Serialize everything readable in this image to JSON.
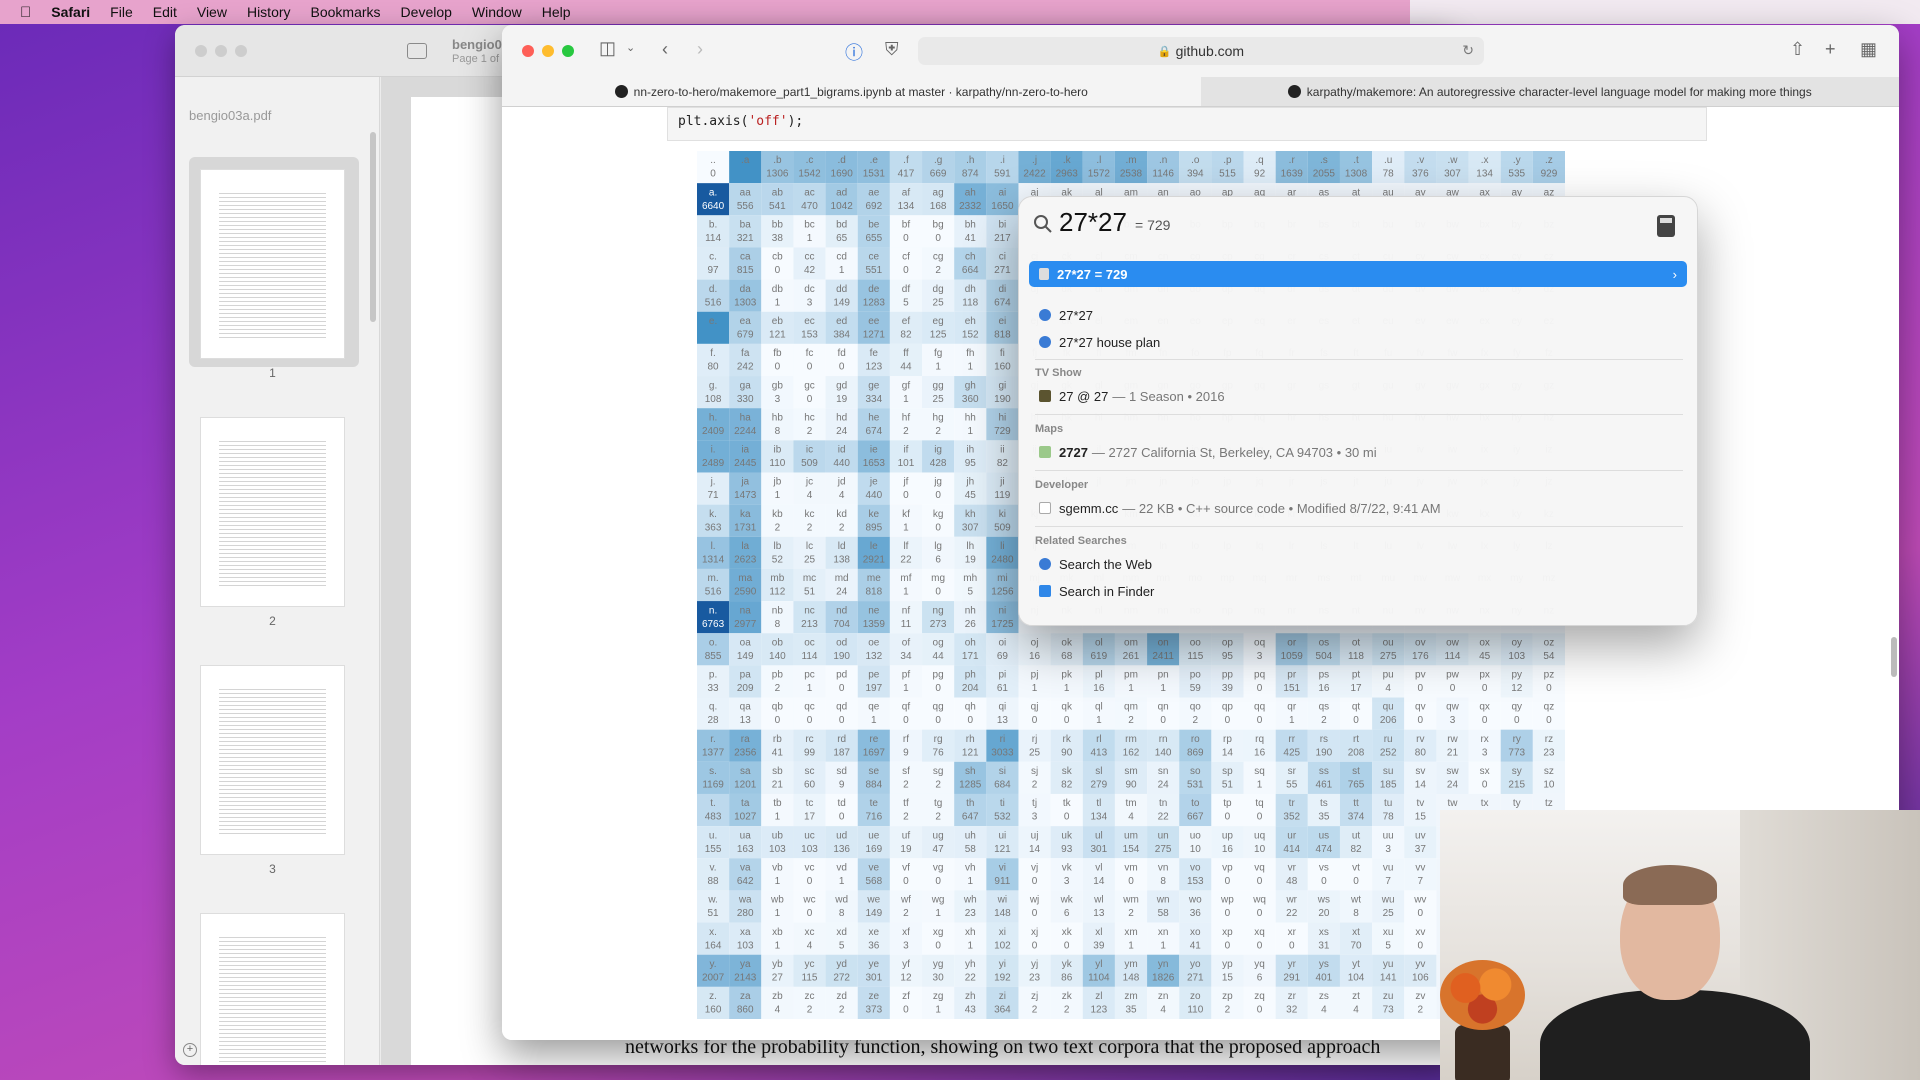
{
  "menubar": {
    "app": "Safari",
    "items": [
      "File",
      "Edit",
      "View",
      "History",
      "Bookmarks",
      "Develop",
      "Window",
      "Help"
    ]
  },
  "preview": {
    "doc_title": "bengio0",
    "page_info": "Page 1 of",
    "sidebar_label": "bengio03a.pdf",
    "thumb_numbers": [
      "1",
      "2",
      "3"
    ],
    "body_text": "networks for the probability function, showing on two text corpora that the proposed approach"
  },
  "safari": {
    "url": "github.com",
    "tabs": [
      {
        "label": "nn-zero-to-hero/makemore_part1_bigrams.ipynb at master · karpathy/nn-zero-to-hero",
        "active": true
      },
      {
        "label": "karpathy/makemore: An autoregressive character-level language model for making more things",
        "active": false
      }
    ],
    "code": {
      "prefix": "plt.axis(",
      "string": "'off'",
      "suffix": ");"
    }
  },
  "spotlight": {
    "query": "27*27",
    "inline_result": "= 729",
    "selected": "27*27 = 729",
    "suggestions": [
      {
        "label": "27*27",
        "icon": "safari-icon"
      },
      {
        "label": "27*27 house plan",
        "icon": "safari-icon"
      }
    ],
    "sections": [
      {
        "header": "TV Show",
        "items": [
          {
            "label": "27 @ 27",
            "meta": "— 1 Season • 2016",
            "icon": "tv-icon"
          }
        ]
      },
      {
        "header": "Maps",
        "items": [
          {
            "label": "2727",
            "meta": "— 2727 California St, Berkeley, CA 94703 • 30 mi",
            "icon": "maps-icon"
          }
        ]
      },
      {
        "header": "Developer",
        "items": [
          {
            "label": "sgemm.cc",
            "meta": "— 22 KB • C++ source code • Modified 8/7/22, 9:41 AM",
            "icon": "file-icon"
          }
        ]
      },
      {
        "header": "Related Searches",
        "items": [
          {
            "label": "Search the Web",
            "meta": "",
            "icon": "safari-icon"
          },
          {
            "label": "Search in Finder",
            "meta": "",
            "icon": "finder-icon"
          }
        ]
      }
    ]
  },
  "chart_data": {
    "type": "heatmap",
    "title": "",
    "columns": [
      ".",
      "a",
      "b",
      "c",
      "d",
      "e",
      "f",
      "g",
      "h",
      "i",
      "j",
      "k",
      "l",
      "m",
      "n",
      "o",
      "p",
      "q",
      "r",
      "s",
      "t",
      "u",
      "v",
      "w",
      "x",
      "y",
      "z"
    ],
    "rows": [
      {
        "label": ".",
        "values": [
          0,
          null,
          1306,
          1542,
          1690,
          1531,
          417,
          669,
          874,
          591,
          2422,
          2963,
          1572,
          2538,
          1146,
          394,
          515,
          92,
          1639,
          2055,
          1308,
          78,
          376,
          307,
          134,
          535,
          929
        ]
      },
      {
        "label": "a",
        "values": [
          6640,
          556,
          541,
          470,
          1042,
          692,
          134,
          168,
          2332,
          1650
        ]
      },
      {
        "label": "b",
        "values": [
          114,
          321,
          38,
          1,
          65,
          655,
          0,
          0,
          41,
          217
        ]
      },
      {
        "label": "c",
        "values": [
          97,
          815,
          0,
          42,
          1,
          551,
          0,
          2,
          664,
          271
        ]
      },
      {
        "label": "d",
        "values": [
          516,
          1303,
          1,
          3,
          149,
          1283,
          5,
          25,
          118,
          674
        ]
      },
      {
        "label": "e",
        "values": [
          null,
          679,
          121,
          153,
          384,
          1271,
          82,
          125,
          152,
          818
        ]
      },
      {
        "label": "f",
        "values": [
          80,
          242,
          0,
          0,
          0,
          123,
          44,
          1,
          1,
          160
        ]
      },
      {
        "label": "g",
        "values": [
          108,
          330,
          3,
          0,
          19,
          334,
          1,
          25,
          360,
          190
        ]
      },
      {
        "label": "h",
        "values": [
          2409,
          2244,
          8,
          2,
          24,
          674,
          2,
          2,
          1,
          729
        ]
      },
      {
        "label": "i",
        "values": [
          2489,
          2445,
          110,
          509,
          440,
          1653,
          101,
          428,
          95,
          82
        ]
      },
      {
        "label": "j",
        "values": [
          71,
          1473,
          1,
          4,
          4,
          440,
          0,
          0,
          45,
          119
        ]
      },
      {
        "label": "k",
        "values": [
          363,
          1731,
          2,
          2,
          2,
          895,
          1,
          0,
          307,
          509
        ]
      },
      {
        "label": "l",
        "values": [
          1314,
          2623,
          52,
          25,
          138,
          2921,
          22,
          6,
          19,
          2480
        ]
      },
      {
        "label": "m",
        "values": [
          516,
          2590,
          112,
          51,
          24,
          818,
          1,
          0,
          5,
          1256
        ]
      },
      {
        "label": "n",
        "values": [
          6763,
          2977,
          8,
          213,
          704,
          1359,
          11,
          273,
          26,
          1725
        ]
      },
      {
        "label": "o",
        "values": [
          855,
          149,
          140,
          114,
          190,
          132,
          34,
          44,
          171,
          69,
          16,
          68,
          619,
          261,
          2411,
          115,
          95,
          3,
          1059,
          504,
          118,
          275,
          176,
          114,
          45,
          103,
          54
        ]
      },
      {
        "label": "p",
        "values": [
          33,
          209,
          2,
          1,
          0,
          197,
          1,
          0,
          204,
          61,
          1,
          1,
          16,
          1,
          1,
          59,
          39,
          0,
          151,
          16,
          17,
          4,
          0,
          0,
          0,
          12,
          0
        ]
      },
      {
        "label": "q",
        "values": [
          28,
          13,
          0,
          0,
          0,
          1,
          0,
          0,
          0,
          13,
          0,
          0,
          1,
          2,
          0,
          2,
          0,
          0,
          1,
          2,
          0,
          206,
          0,
          3,
          0,
          0,
          0
        ]
      },
      {
        "label": "r",
        "values": [
          1377,
          2356,
          41,
          99,
          187,
          1697,
          9,
          76,
          121,
          3033,
          25,
          90,
          413,
          162,
          140,
          869,
          14,
          16,
          425,
          190,
          208,
          252,
          80,
          21,
          3,
          773,
          23
        ]
      },
      {
        "label": "s",
        "values": [
          1169,
          1201,
          21,
          60,
          9,
          884,
          2,
          2,
          1285,
          684,
          2,
          82,
          279,
          90,
          24,
          531,
          51,
          1,
          55,
          461,
          765,
          185,
          14,
          24,
          0,
          215,
          10
        ]
      },
      {
        "label": "t",
        "values": [
          483,
          1027,
          1,
          17,
          0,
          716,
          2,
          2,
          647,
          532,
          3,
          0,
          134,
          4,
          22,
          667,
          0,
          0,
          352,
          35,
          374,
          78,
          15
        ]
      },
      {
        "label": "u",
        "values": [
          155,
          163,
          103,
          103,
          136,
          169,
          19,
          47,
          58,
          121,
          14,
          93,
          301,
          154,
          275,
          10,
          16,
          10,
          414,
          474,
          82,
          3,
          37
        ]
      },
      {
        "label": "v",
        "values": [
          88,
          642,
          1,
          0,
          1,
          568,
          0,
          0,
          1,
          911,
          0,
          3,
          14,
          0,
          8,
          153,
          0,
          0,
          48,
          0,
          0,
          7,
          7
        ]
      },
      {
        "label": "w",
        "values": [
          51,
          280,
          1,
          0,
          8,
          149,
          2,
          1,
          23,
          148,
          0,
          6,
          13,
          2,
          58,
          36,
          0,
          0,
          22,
          20,
          8,
          25,
          0
        ]
      },
      {
        "label": "x",
        "values": [
          164,
          103,
          1,
          4,
          5,
          36,
          3,
          0,
          1,
          102,
          0,
          0,
          39,
          1,
          1,
          41,
          0,
          0,
          0,
          31,
          70,
          5,
          0
        ]
      },
      {
        "label": "y",
        "values": [
          2007,
          2143,
          27,
          115,
          272,
          301,
          12,
          30,
          22,
          192,
          23,
          86,
          1104,
          148,
          1826,
          271,
          15,
          6,
          291,
          401,
          104,
          141,
          106
        ]
      },
      {
        "label": "z",
        "values": [
          160,
          860,
          4,
          2,
          2,
          373,
          0,
          1,
          43,
          364,
          2,
          2,
          123,
          35,
          4,
          110,
          2,
          0,
          32,
          4,
          4,
          73,
          2
        ]
      }
    ]
  },
  "colors": {
    "heat_low": "#f7fbff",
    "heat_high": "#08519c",
    "spotlight_selected": "#2a8cf0"
  }
}
